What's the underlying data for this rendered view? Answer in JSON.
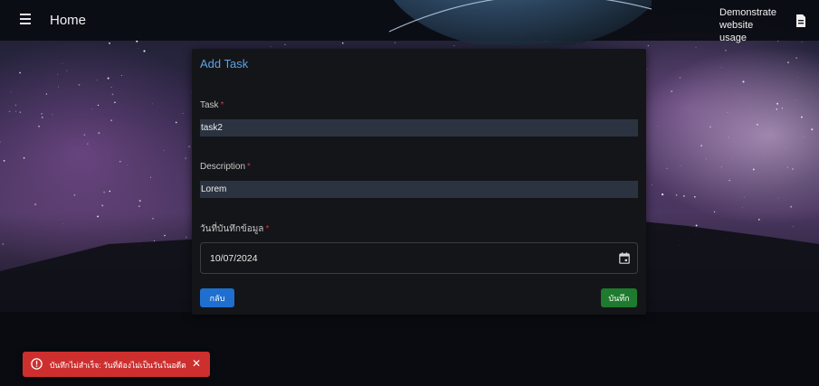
{
  "header": {
    "title": "Home",
    "demo_link": "Demonstrate website usage",
    "menu_icon": "hamburger-menu-icon",
    "doc_icon": "document-icon"
  },
  "form": {
    "title": "Add Task",
    "task_label": "Task",
    "task_value": "task2",
    "description_label": "Description",
    "description_value": "Lorem",
    "date_label": "วันที่บันทึกข้อมูล",
    "date_value": "10/07/2024",
    "required_mark": "*",
    "back_label": "กลับ",
    "save_label": "บันทึก"
  },
  "toast": {
    "message": "บันทึกไม่สำเร็จ: วันที่ต้องไม่เป็นวันในอดีต",
    "close": "✕"
  },
  "colors": {
    "title_blue": "#5aa3e8",
    "back_button": "#1f6fcf",
    "save_button": "#1e7a2e",
    "error_toast": "#cd2f2f",
    "required": "#d0343d"
  }
}
